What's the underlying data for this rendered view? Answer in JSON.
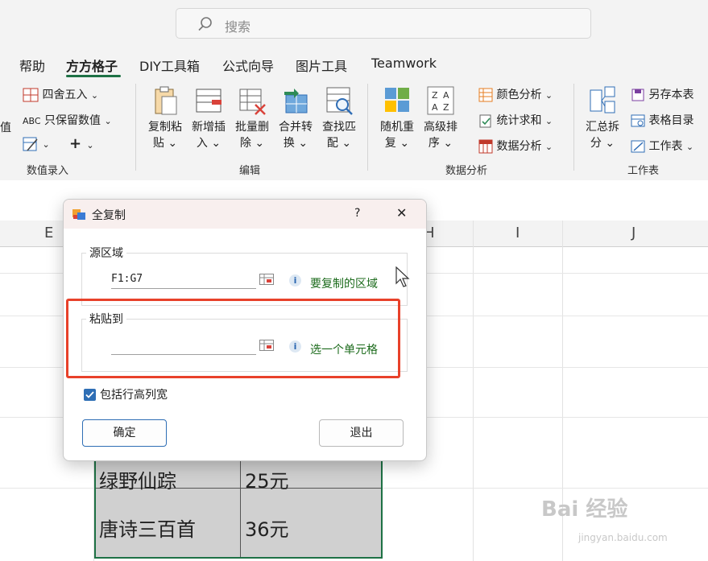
{
  "search": {
    "placeholder": "搜索"
  },
  "tabs": [
    {
      "label": "帮助"
    },
    {
      "label": "方方格子"
    },
    {
      "label": "DIY工具箱"
    },
    {
      "label": "公式向导"
    },
    {
      "label": "图片工具"
    },
    {
      "label": "Teamwork"
    }
  ],
  "ribbon": {
    "group_input": {
      "label": "数值录入",
      "round": "四舍五入",
      "keep_values": "只保留数值",
      "abc": "ABC",
      "plus": "+",
      "left_cut": "值"
    },
    "group_edit": {
      "label": "编辑",
      "buttons": [
        {
          "line1": "复制粘",
          "line2": "贴"
        },
        {
          "line1": "新增插",
          "line2": "入"
        },
        {
          "line1": "批量删",
          "line2": "除"
        },
        {
          "line1": "合并转",
          "line2": "换"
        },
        {
          "line1": "查找匹",
          "line2": "配"
        }
      ]
    },
    "group_analysis": {
      "label": "数据分析",
      "buttons": [
        {
          "line1": "随机重",
          "line2": "复"
        },
        {
          "line1": "高级排",
          "line2": "序"
        }
      ],
      "small": [
        "颜色分析",
        "统计求和",
        "数据分析"
      ]
    },
    "group_sheet": {
      "label": "工作表",
      "big": {
        "line1": "汇总拆",
        "line2": "分"
      },
      "small": [
        "另存本表",
        "表格目录",
        "工作表"
      ]
    }
  },
  "sheet": {
    "columns": [
      "E",
      "H",
      "I",
      "J"
    ],
    "rows": [
      {
        "name": "绿野仙踪",
        "price": "25元"
      },
      {
        "name": "唐诗三百首",
        "price": "36元"
      }
    ]
  },
  "dialog": {
    "title": "全复制",
    "help": "?",
    "close": "✕",
    "source_label": "源区域",
    "source_value": "F1:G7",
    "source_hint": "要复制的区域",
    "paste_label": "粘贴到",
    "paste_value": "",
    "paste_hint": "选一个单元格",
    "include_label": "包括行高列宽",
    "include_checked": true,
    "ok": "确定",
    "exit": "退出"
  },
  "watermark": {
    "main": "Bai 经验",
    "sub": "jingyan.baidu.com"
  },
  "colors": {
    "accent": "#1e7145",
    "highlight": "#e8412a",
    "hint": "#1c6b1c"
  }
}
